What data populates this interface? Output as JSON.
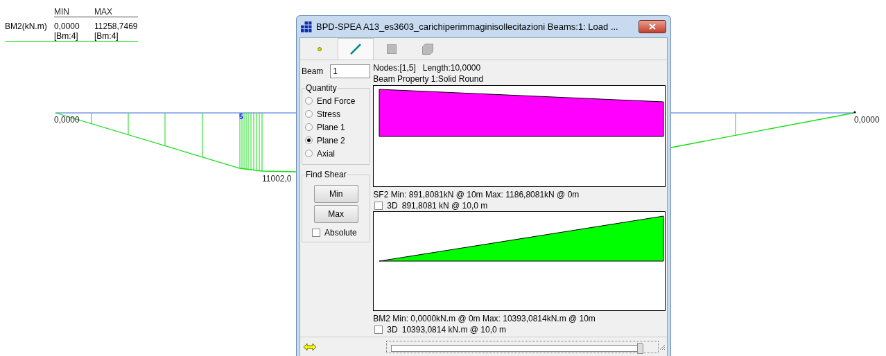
{
  "legend": {
    "headers": [
      "MIN",
      "MAX"
    ],
    "label": "BM2(kN.m)",
    "min": "0,0000",
    "max": "11258,7469",
    "min_beam": "[Bm:4]",
    "max_beam": "[Bm:4]"
  },
  "canvas_labels": [
    "0,0000",
    "5",
    "11002,0",
    "0,0000"
  ],
  "window": {
    "title": "BPD-SPEA A13_es3603_carichiperimmaginisollecitazioni Beams:1: Load ...",
    "toolbar_tabs": [
      {
        "kind": "node",
        "selected": false
      },
      {
        "kind": "beam",
        "selected": true
      },
      {
        "kind": "plate",
        "selected": false
      },
      {
        "kind": "solid",
        "selected": false
      }
    ],
    "beam_field": {
      "label": "Beam",
      "value": "1"
    },
    "info": [
      "Nodes:[1,5]",
      "Length:10,0000",
      "Beam Property 1:Solid Round"
    ],
    "quantity": {
      "title": "Quantity",
      "options": [
        {
          "label": "End Force",
          "selected": false
        },
        {
          "label": "Stress",
          "selected": false
        },
        {
          "label": "Plane 1",
          "selected": false
        },
        {
          "label": "Plane 2",
          "selected": true
        },
        {
          "label": "Axial",
          "selected": false
        }
      ]
    },
    "find_shear": {
      "title": "Find Shear",
      "buttons": [
        "Min",
        "Max"
      ],
      "absolute": {
        "label": "Absolute",
        "checked": false
      }
    },
    "plots": [
      {
        "kind": "shear",
        "color": "#ff00ff",
        "summary": "SF2 Min: 891,8081kN @ 10m  Max: 1186,8081kN @ 0m",
        "three_d": {
          "label": "3D",
          "checked": false
        },
        "reading": "891,8081 kN @ 10,0 m"
      },
      {
        "kind": "moment",
        "color": "#00ff00",
        "summary": "BM2 Min: 0,0000kN.m @ 0m  Max: 10393,0814kN.m @ 10m",
        "three_d": {
          "label": "3D",
          "checked": false
        },
        "reading": "10393,0814 kN.m @ 10,0 m"
      }
    ],
    "slider": {
      "level": 1
    }
  }
}
